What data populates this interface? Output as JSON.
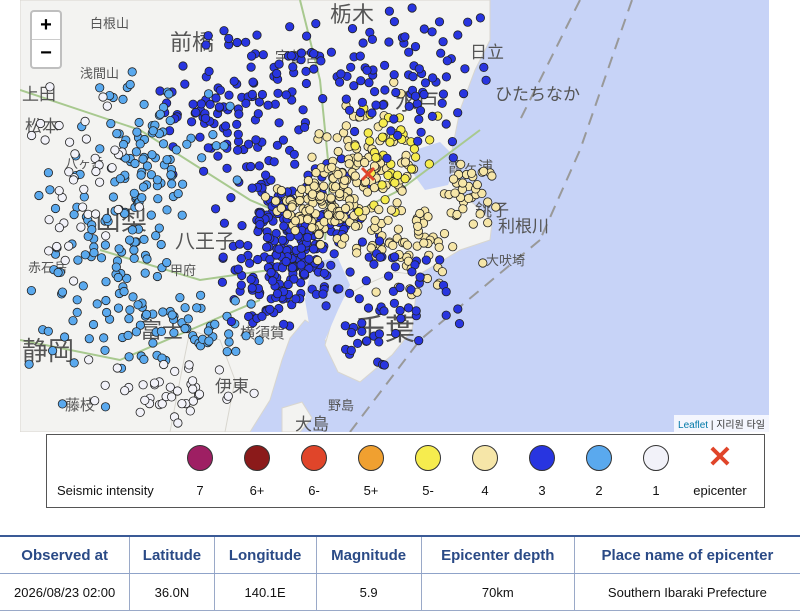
{
  "map": {
    "zoom_in_label": "+",
    "zoom_out_label": "−",
    "attribution": {
      "leaflet": "Leaflet",
      "separator": " | ",
      "tiles": "지리원 타일"
    },
    "place_labels": [
      "白根山",
      "宇都宮",
      "栃木",
      "日立",
      "ひたちなか",
      "浅間山",
      "前橋",
      "松本",
      "水戸",
      "八ヶ岳",
      "霞ヶ浦",
      "山梨",
      "銚子",
      "利根川",
      "八王子",
      "甲府",
      "大吠埼",
      "赤石岳",
      "富士",
      "千葉",
      "横須賀",
      "静岡",
      "伊東",
      "藤枝",
      "大島",
      "野島",
      "上田"
    ],
    "colors": {
      "intensity_1": "#f2f2f9",
      "intensity_2": "#5aa9ee",
      "intensity_3": "#2835e0",
      "intensity_4": "#f6e6a8",
      "intensity_5m": "#f6ec4e",
      "land": "#f3f3f1",
      "sea": "#c7d3f7"
    }
  },
  "legend": {
    "title": "Seismic intensity",
    "items": [
      {
        "label": "7",
        "color": "#9e1f63"
      },
      {
        "label": "6+",
        "color": "#8b1a1a"
      },
      {
        "label": "6-",
        "color": "#e0452a"
      },
      {
        "label": "5+",
        "color": "#f0a030"
      },
      {
        "label": "5-",
        "color": "#f6ec4e"
      },
      {
        "label": "4",
        "color": "#f6e6a8"
      },
      {
        "label": "3",
        "color": "#2835e0"
      },
      {
        "label": "2",
        "color": "#5aa9ee"
      },
      {
        "label": "1",
        "color": "#f2f2f9"
      }
    ],
    "epicenter_label": "epicenter",
    "epicenter_color": "#e0452a"
  },
  "table": {
    "headers": [
      "Observed at",
      "Latitude",
      "Longitude",
      "Magnitude",
      "Epicenter depth",
      "Place name of epicenter"
    ],
    "row": [
      "2026/08/23 02:00",
      "36.0N",
      "140.1E",
      "5.9",
      "70km",
      "Southern Ibaraki Prefecture"
    ]
  }
}
